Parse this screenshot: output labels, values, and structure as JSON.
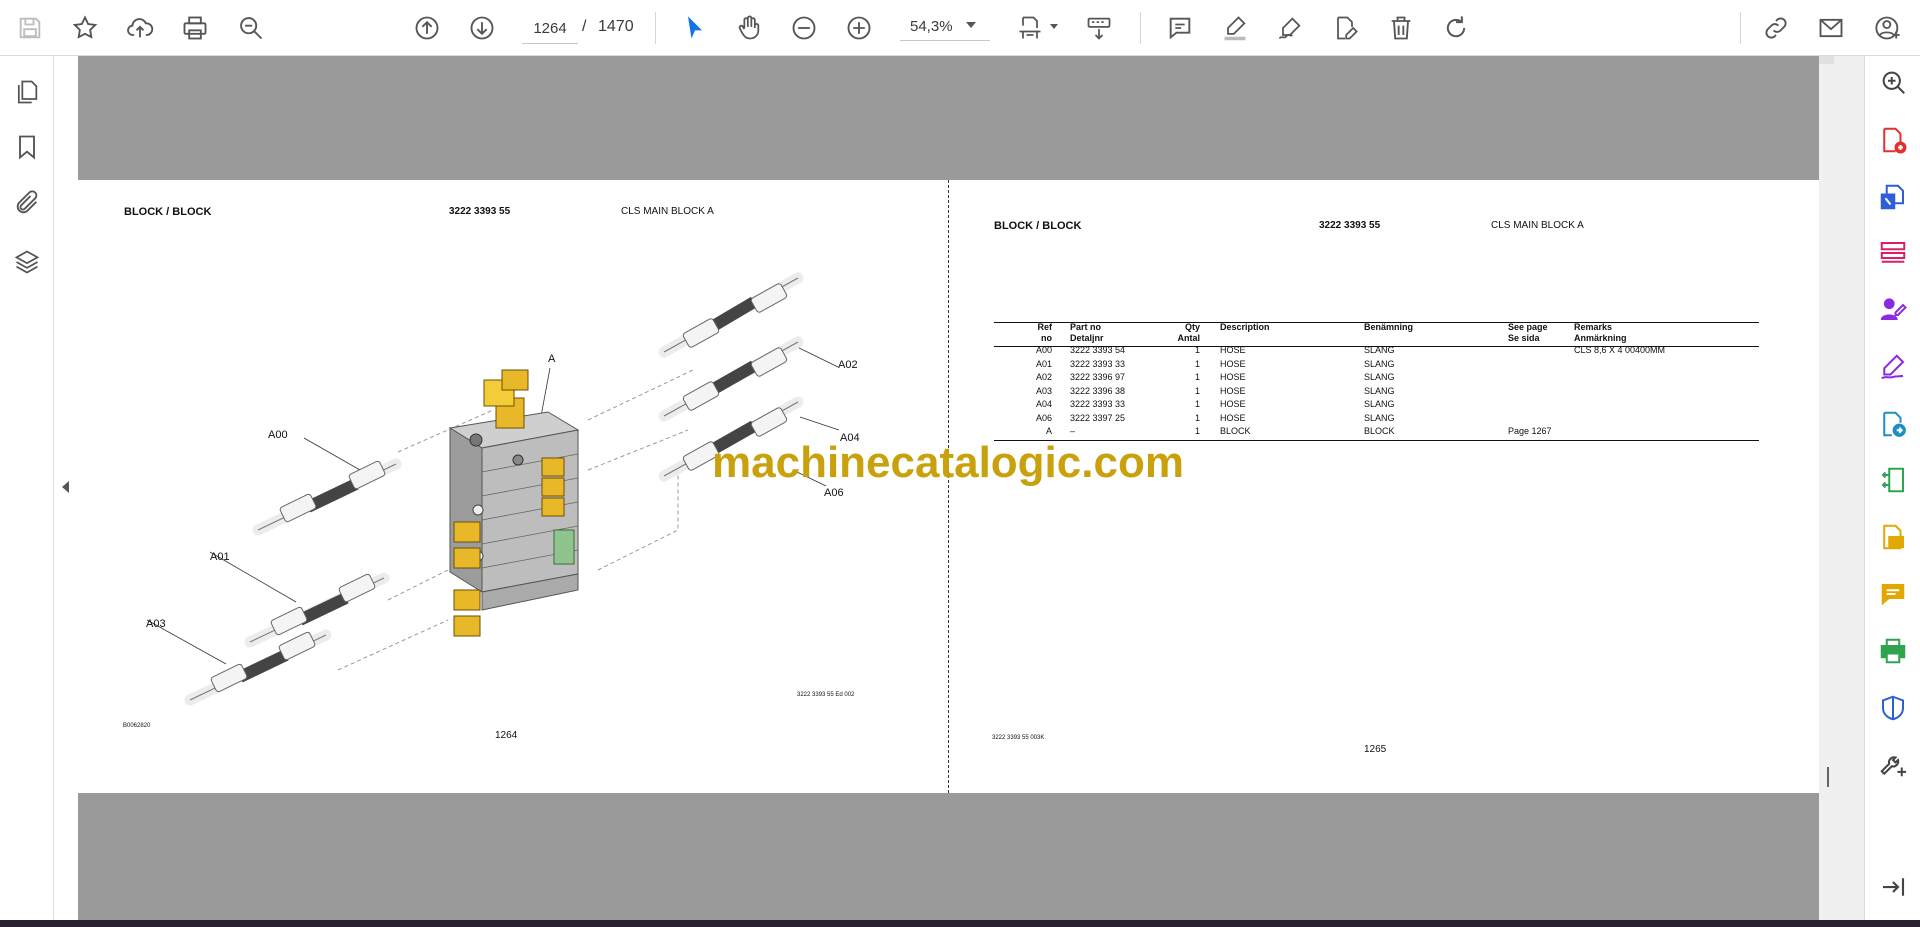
{
  "toolbar": {
    "page_current": "1264",
    "page_separator": "/",
    "page_total": "1470",
    "zoom": "54,3%",
    "icons": [
      "save-icon",
      "bookmark-star-icon",
      "upload-cloud-icon",
      "print-icon",
      "zoom-search-icon",
      "page-up-icon",
      "page-down-icon",
      "select-cursor-icon",
      "hand-icon",
      "zoom-out-icon",
      "zoom-in-icon",
      "fit-page-icon",
      "scroll-mode-icon",
      "comment-icon",
      "highlight-icon",
      "sign-icon",
      "edit-icon",
      "delete-icon",
      "rotate-icon",
      "link-icon",
      "email-icon",
      "account-icon"
    ]
  },
  "left_panel": {
    "icons": [
      "pages-icon",
      "bookmark-icon",
      "attachment-icon",
      "layers-icon"
    ]
  },
  "right_panel": {
    "icons": [
      "zoom-search-icon",
      "create-pdf-icon",
      "export-pdf-icon",
      "organize-pages-icon",
      "request-signature-icon",
      "fill-sign-icon",
      "send-review-icon",
      "compress-pdf-icon",
      "scan-ocr-icon",
      "add-comment-icon",
      "print-production-icon",
      "protect-icon",
      "more-tools-icon",
      "collapse-panel-icon"
    ]
  },
  "document": {
    "left": {
      "title": "BLOCK / BLOCK",
      "partno": "3222 3393 55",
      "name": "CLS MAIN BLOCK A",
      "labels": {
        "a": "A",
        "a00": "A00",
        "a01": "A01",
        "a02": "A02",
        "a03": "A03",
        "a04": "A04",
        "a06": "A06"
      },
      "drawing_ref": "3222 3393 55 Ed 002",
      "image_ref": "B0062820",
      "page_number": "1264"
    },
    "right": {
      "title": "BLOCK / BLOCK",
      "partno": "3222 3393 55",
      "name": "CLS MAIN BLOCK A",
      "headers": {
        "ref1": "Ref",
        "ref2": "no",
        "part1": "Part no",
        "part2": "Detaljnr",
        "qty1": "Qty",
        "qty2": "Antal",
        "desc": "Description",
        "ben": "Benämning",
        "see1": "See page",
        "see2": "Se sida",
        "rem1": "Remarks",
        "rem2": "Anmärkning"
      },
      "rows": [
        {
          "ref": "A00",
          "part": "3222 3393 54",
          "qty": "1",
          "desc": "HOSE",
          "ben": "SLANG",
          "see": "",
          "rem": "CLS 8,6 X 4  00400MM"
        },
        {
          "ref": "A01",
          "part": "3222 3393 33",
          "qty": "1",
          "desc": "HOSE",
          "ben": "SLANG",
          "see": "",
          "rem": ""
        },
        {
          "ref": "A02",
          "part": "3222 3396 97",
          "qty": "1",
          "desc": "HOSE",
          "ben": "SLANG",
          "see": "",
          "rem": ""
        },
        {
          "ref": "A03",
          "part": "3222 3396 38",
          "qty": "1",
          "desc": "HOSE",
          "ben": "SLANG",
          "see": "",
          "rem": ""
        },
        {
          "ref": "A04",
          "part": "3222 3393 33",
          "qty": "1",
          "desc": "HOSE",
          "ben": "SLANG",
          "see": "",
          "rem": ""
        },
        {
          "ref": "A06",
          "part": "3222 3397 25",
          "qty": "1",
          "desc": "HOSE",
          "ben": "SLANG",
          "see": "",
          "rem": ""
        },
        {
          "ref": "A",
          "part": "–",
          "qty": "1",
          "desc": "BLOCK",
          "ben": "BLOCK",
          "see": "Page 1267",
          "rem": ""
        }
      ],
      "footer_ref": "3222 3393 55  003K",
      "page_number": "1265"
    },
    "watermark": "machinecatalogic.com"
  },
  "colors": {
    "accent": "#1473e6",
    "viewer_bg": "#9a9a9a",
    "watermark": "#c9a10c",
    "brass": "#e8b828"
  }
}
